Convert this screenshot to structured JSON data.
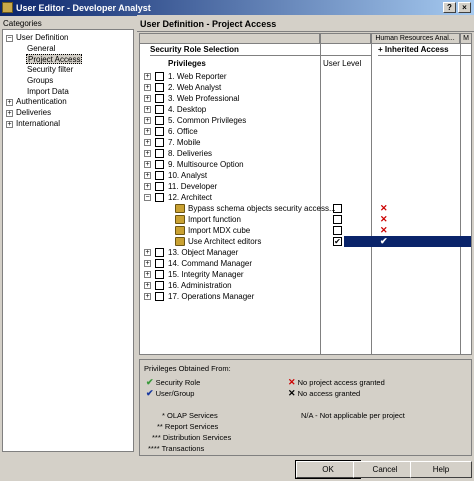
{
  "window": {
    "title": "User Editor - Developer Analyst",
    "buttons": {
      "help": "?",
      "close": "×"
    }
  },
  "categories": {
    "label": "Categories",
    "expand_minus": "−",
    "expand_plus": "+",
    "items": [
      {
        "label": "User Definition"
      },
      {
        "label": "General"
      },
      {
        "label": "Project Access"
      },
      {
        "label": "Security filter"
      },
      {
        "label": "Groups"
      },
      {
        "label": "Import Data"
      },
      {
        "label": "Authentication"
      },
      {
        "label": "Deliveries"
      },
      {
        "label": "International"
      }
    ]
  },
  "panel": {
    "title": "User Definition - Project Access",
    "columns": {
      "project": "Human Resources Anal...",
      "project_more": "M",
      "security_role_selection": "Security Role Selection",
      "inherited_access": "+ Inherited Access",
      "privileges": "Privileges",
      "user_level": "User Level"
    },
    "rows": [
      {
        "label": "1. Web Reporter",
        "exp": "+",
        "mark": "",
        "user": ""
      },
      {
        "label": "2. Web Analyst",
        "exp": "+",
        "mark": "",
        "user": ""
      },
      {
        "label": "3. Web Professional",
        "exp": "+",
        "mark": "",
        "user": ""
      },
      {
        "label": "4. Desktop",
        "exp": "+",
        "mark": "",
        "user": ""
      },
      {
        "label": "5. Common Privileges",
        "exp": "+",
        "mark": "",
        "user": ""
      },
      {
        "label": "6. Office",
        "exp": "+",
        "mark": "",
        "user": ""
      },
      {
        "label": "7. Mobile",
        "exp": "+",
        "mark": "",
        "user": ""
      },
      {
        "label": "8. Deliveries",
        "exp": "+",
        "mark": "",
        "user": ""
      },
      {
        "label": "9. Multisource Option",
        "exp": "+",
        "mark": "",
        "user": ""
      },
      {
        "label": "10. Analyst",
        "exp": "+",
        "mark": "",
        "user": ""
      },
      {
        "label": "11. Developer",
        "exp": "+",
        "mark": "",
        "user": ""
      },
      {
        "label": "12. Architect",
        "exp": "−",
        "mark": "",
        "user": ""
      },
      {
        "label": "Bypass schema objects security access...",
        "child": true,
        "mark": "✕",
        "user": ""
      },
      {
        "label": "Import function",
        "child": true,
        "mark": "✕",
        "user": ""
      },
      {
        "label": "Import MDX cube",
        "child": true,
        "mark": "✕",
        "user": ""
      },
      {
        "label": "Use Architect editors",
        "child": true,
        "mark": "✔",
        "user": "✔",
        "highlight": true
      },
      {
        "label": "13. Object Manager",
        "exp": "+",
        "mark": "",
        "user": ""
      },
      {
        "label": "14. Command Manager",
        "exp": "+",
        "mark": "",
        "user": ""
      },
      {
        "label": "15. Integrity Manager",
        "exp": "+",
        "mark": "",
        "user": ""
      },
      {
        "label": "16. Administration",
        "exp": "+",
        "mark": "",
        "user": ""
      },
      {
        "label": "17. Operations Manager",
        "exp": "+",
        "mark": "",
        "user": ""
      }
    ]
  },
  "legend": {
    "title": "Privileges Obtained From:",
    "security_role": "Security Role",
    "user_group": "User/Group",
    "no_project_access": "No project access granted",
    "no_access": "No access granted",
    "olap": "* OLAP Services",
    "report": "** Report Services",
    "distribution": "*** Distribution Services",
    "transactions": "**** Transactions",
    "na": "N/A - Not applicable per project",
    "glyph_check": "✔",
    "glyph_x": "✕"
  },
  "footer": {
    "ok": "OK",
    "cancel": "Cancel",
    "help": "Help"
  },
  "colors": {
    "selection": "#0a246a",
    "red_x": "#cc0000",
    "green_check": "#3a9a3a",
    "blue_check": "#1a3aa0"
  }
}
